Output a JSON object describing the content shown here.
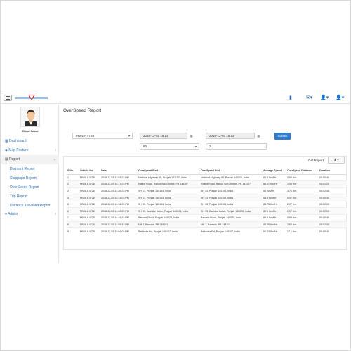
{
  "sidebar": {
    "client_name": "Client Name",
    "items": [
      {
        "label": "Dashboard",
        "icon": "dashboard-icon"
      },
      {
        "label": "Map Feature",
        "icon": "map-marker-icon"
      },
      {
        "label": "Report",
        "icon": "report-icon"
      },
      {
        "label": "Admin",
        "icon": "user-icon"
      }
    ],
    "report_subitems": [
      "Dormant Report",
      "Stoppage Report",
      "OverSpeed Report",
      "Trip Report",
      "Distance Travelled Report"
    ]
  },
  "page": {
    "title": "OverSpeed Report",
    "vehicle_select": "PB01 A 4728",
    "from_date": "2018-12-02 15:13",
    "to_date": "2018-12-03 15:13",
    "speed_select": "80",
    "duration_value": "2",
    "submit_label": "Submit",
    "get_report_label": "Get Report"
  },
  "table": {
    "headers": [
      "S.No.",
      "Vehicle No",
      "Date",
      "OverSpeed Start",
      "OverSpeed End",
      "Average Speed",
      "OverSpeed Distance",
      "Duration"
    ],
    "rows": [
      [
        "1",
        "PB01 A 4728",
        "2018-12-03 13:53:23 PM",
        "National Highway 95, Punjab 141102, India",
        "National Highway 95, Punjab 141102, India",
        "85.5 Km/Hr",
        "0.60 Km",
        "00:00:40"
      ],
      [
        "2",
        "PB01 A 4728",
        "2018-12-03 14:17:23 PM",
        "Raikot Road, Raikot Sub-District, PB 141107",
        "Raikot Road, Raikot Sub-District, PB 141107",
        "84.57 Km/Hr",
        "1.96 Km",
        "00:01:20"
      ],
      [
        "3",
        "PB01 A 4728",
        "2018-12-03 14:26:23 PM",
        "SH 13, Punjab 140104, India",
        "SH 13, Punjab 140104, India",
        "84 Km/Hr",
        "3.71 Km",
        "00:02:40"
      ],
      [
        "4",
        "PB01 A 4728",
        "2018-12-03 14:31:03 PM",
        "SH 13, Punjab 140104, India",
        "SH 13, Punjab 140104, India",
        "83.6 Km/Hr",
        "0.97 Km",
        "00:00:40"
      ],
      [
        "5",
        "PB01 A 4728",
        "2018-12-03 14:34:23 PM",
        "SH 13, Punjab 140104, India",
        "SH 13, Punjab 140104, India",
        "83.75 Km/Hr",
        "2.07 Km",
        "00:02:00"
      ],
      [
        "6",
        "PB01 A 4728",
        "2018-12-03 14:42:23 PM",
        "SH 13, Bazidke Kalan, Punjab 140025, India",
        "SH 13, Bazidke Kalan, Punjab 140025, India",
        "82.5 Km/Hr",
        "2.57 Km",
        "00:02:00"
      ],
      [
        "7",
        "PB01 A 4728",
        "2018-12-03 14:49:23 PM",
        "Barnala Road, Punjab 140025, India",
        "Barnala Road, Punjab 140025, India",
        "85.5 Km/Hr",
        "0.69 Km",
        "00:00:40"
      ],
      [
        "8",
        "PB01 A 4728",
        "2018-12-03 14:55:43 PM",
        "NH 7, Barnala, PB 148101",
        "NH 7, Barnala, PB 148101",
        "88.25 Km/Hr",
        "2.60 Km",
        "00:02:00"
      ],
      [
        "9",
        "PB01 A 4728",
        "2018-12-03 15:01:03 PM",
        "Bathinda Rd, Punjab 148107, India",
        "Bathinda Rd, Punjab 148107, India",
        "90.33 Km/Hr",
        "17.1 Km",
        "00:00:40"
      ]
    ]
  },
  "colors": {
    "accent": "#2f7bd0",
    "link": "#2f6fb3",
    "border": "#e4e4e4"
  }
}
